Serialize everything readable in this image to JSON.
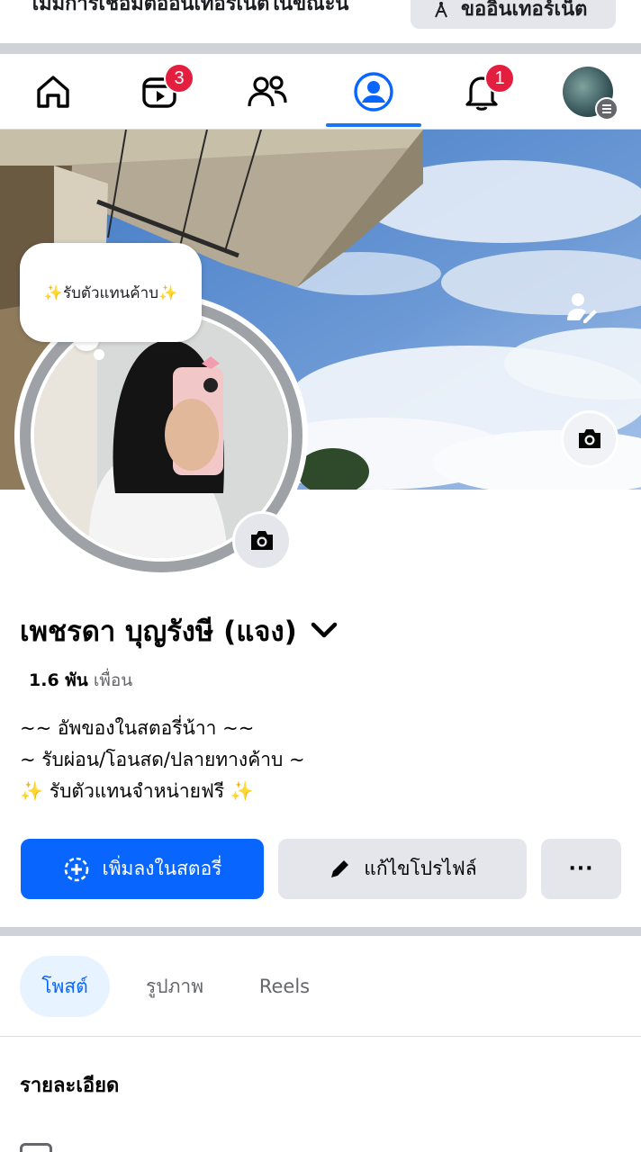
{
  "offline_banner": {
    "message": "ไม่มีการเชื่อมต่ออินเทอร์เน็ตในขณะนี้",
    "button_label": "ขออินเทอร์เน็ต"
  },
  "nav": {
    "items": [
      {
        "name": "home",
        "icon": "home-icon"
      },
      {
        "name": "video",
        "icon": "video-icon",
        "badge": "3"
      },
      {
        "name": "friends",
        "icon": "friends-icon"
      },
      {
        "name": "profile",
        "icon": "profile-icon",
        "active": true
      },
      {
        "name": "notifications",
        "icon": "bell-icon",
        "badge": "1"
      },
      {
        "name": "menu",
        "icon": "avatar-menu-icon"
      }
    ]
  },
  "profile": {
    "note": "✨รับตัวแทนค้าบ✨",
    "name": "เพชรดา บุญรังษี (แจง)",
    "friends_count": "1.6 พัน",
    "friends_label": "เพื่อน",
    "bio": [
      "~~ อัพของในสตอรี่น้าา ~~",
      "~ รับผ่อน/โอนสด/ปลายทางค้าบ ~",
      "✨ รับตัวแทนจำหน่ายฟรี ✨"
    ]
  },
  "actions": {
    "add_story": "เพิ่มลงในสตอรี่",
    "edit_profile": "แก้ไขโปรไฟล์",
    "more": "···"
  },
  "tabs": [
    {
      "label": "โพสต์",
      "active": true
    },
    {
      "label": "รูปภาพ"
    },
    {
      "label": "Reels"
    }
  ],
  "details": {
    "title": "รายละเอียด"
  },
  "colors": {
    "accent": "#0866ff",
    "badge": "#e41e3f",
    "button_grey": "#e4e6eb"
  }
}
